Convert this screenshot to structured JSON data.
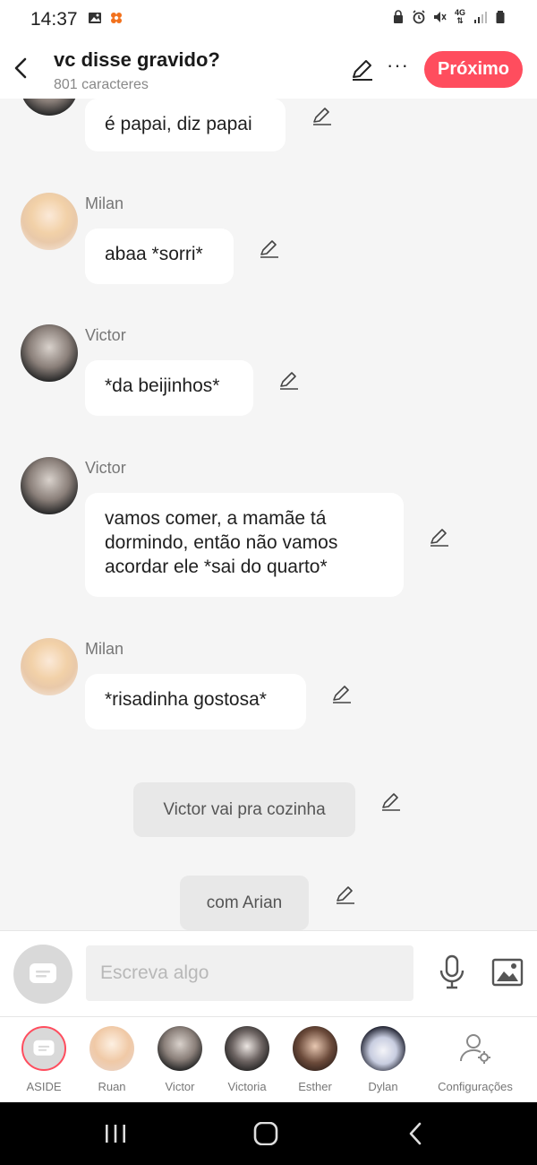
{
  "status_bar": {
    "time": "14:37",
    "network": "4G"
  },
  "header": {
    "title": "vc disse gravido?",
    "subtitle": "801 caracteres",
    "more_label": "···",
    "next_label": "Próximo"
  },
  "messages": [
    {
      "speaker": "",
      "text": "é papai, diz papai"
    },
    {
      "speaker": "Milan",
      "text": "abaa *sorri*"
    },
    {
      "speaker": "Victor",
      "text": "*da beijinhos*"
    },
    {
      "speaker": "Victor",
      "text": "vamos comer, a mamãe tá dormindo, então não vamos acordar ele *sai do quarto*"
    },
    {
      "speaker": "Milan",
      "text": "*risadinha gostosa*"
    }
  ],
  "narrations": [
    "Victor vai pra cozinha",
    "com Arian"
  ],
  "composer": {
    "placeholder": "Escreva algo"
  },
  "characters": [
    {
      "name": "ASIDE"
    },
    {
      "name": "Ruan"
    },
    {
      "name": "Victor"
    },
    {
      "name": "Victoria"
    },
    {
      "name": "Esther"
    },
    {
      "name": "Dylan"
    },
    {
      "name": "Configurações"
    }
  ],
  "colors": {
    "accent": "#ff4d5e",
    "background": "#f5f5f5",
    "bubble": "#ffffff",
    "narration": "#e8e8e8"
  }
}
